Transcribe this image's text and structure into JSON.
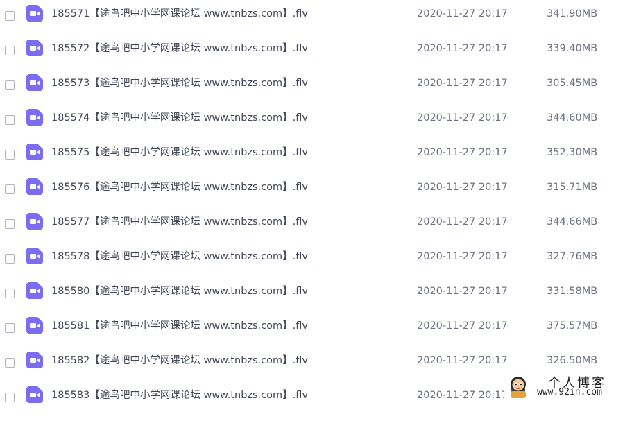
{
  "icon": {
    "name": "video-file-icon",
    "color": "#7c6cf0"
  },
  "files": [
    {
      "name": "185571【途鸟吧中小学网课论坛 www.tnbzs.com】.flv",
      "date": "2020-11-27 20:17",
      "size": "341.90MB"
    },
    {
      "name": "185572【途鸟吧中小学网课论坛 www.tnbzs.com】.flv",
      "date": "2020-11-27 20:17",
      "size": "339.40MB"
    },
    {
      "name": "185573【途鸟吧中小学网课论坛 www.tnbzs.com】.flv",
      "date": "2020-11-27 20:17",
      "size": "305.45MB"
    },
    {
      "name": "185574【途鸟吧中小学网课论坛 www.tnbzs.com】.flv",
      "date": "2020-11-27 20:17",
      "size": "344.60MB"
    },
    {
      "name": "185575【途鸟吧中小学网课论坛 www.tnbzs.com】.flv",
      "date": "2020-11-27 20:17",
      "size": "352.30MB"
    },
    {
      "name": "185576【途鸟吧中小学网课论坛 www.tnbzs.com】.flv",
      "date": "2020-11-27 20:17",
      "size": "315.71MB"
    },
    {
      "name": "185577【途鸟吧中小学网课论坛 www.tnbzs.com】.flv",
      "date": "2020-11-27 20:17",
      "size": "344.66MB"
    },
    {
      "name": "185578【途鸟吧中小学网课论坛 www.tnbzs.com】.flv",
      "date": "2020-11-27 20:17",
      "size": "327.76MB"
    },
    {
      "name": "185580【途鸟吧中小学网课论坛 www.tnbzs.com】.flv",
      "date": "2020-11-27 20:17",
      "size": "331.58MB"
    },
    {
      "name": "185581【途鸟吧中小学网课论坛 www.tnbzs.com】.flv",
      "date": "2020-11-27 20:17",
      "size": "375.57MB"
    },
    {
      "name": "185582【途鸟吧中小学网课论坛 www.tnbzs.com】.flv",
      "date": "2020-11-27 20:17",
      "size": "326.50MB"
    },
    {
      "name": "185583【途鸟吧中小学网课论坛 www.tnbzs.com】.flv",
      "date": "2020-11-27 20:17",
      "size": ""
    }
  ],
  "watermark": {
    "title": "个人博客",
    "url": "www.92in.com"
  }
}
